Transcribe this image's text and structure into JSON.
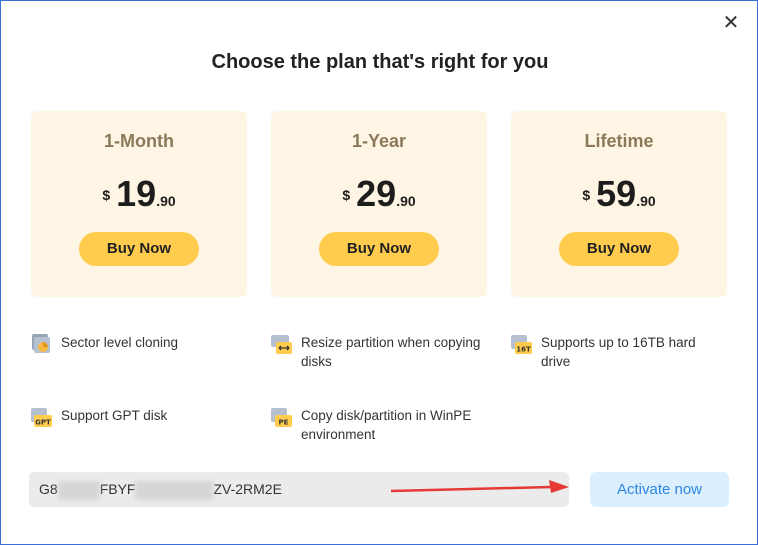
{
  "dialog": {
    "close_glyph": "✕",
    "title": "Choose the plan that's right for you"
  },
  "plans": [
    {
      "name": "1-Month",
      "currency": "$",
      "price_int": "19",
      "price_dec": ".90",
      "button": "Buy Now"
    },
    {
      "name": "1-Year",
      "currency": "$",
      "price_int": "29",
      "price_dec": ".90",
      "button": "Buy Now"
    },
    {
      "name": "Lifetime",
      "currency": "$",
      "price_int": "59",
      "price_dec": ".90",
      "button": "Buy Now"
    }
  ],
  "features": [
    {
      "icon": "sector-clone-icon",
      "line1": "Sector level cloning",
      "line2": ""
    },
    {
      "icon": "resize-partition-icon",
      "line1": "Resize partition when copying",
      "line2": "disks"
    },
    {
      "icon": "16tb-disk-icon",
      "line1": "Supports up to 16TB hard",
      "line2": "drive",
      "badge": "16T"
    },
    {
      "icon": "gpt-disk-icon",
      "line1": "Support GPT disk",
      "line2": "",
      "badge": "GPT"
    },
    {
      "icon": "winpe-disk-icon",
      "line1": "Copy disk/partition in WinPE",
      "line2": "environment",
      "badge": "PE"
    }
  ],
  "license": {
    "part1": "G8",
    "part2": "FBYF",
    "part3": "ZV-2RM2E",
    "activate_label": "Activate now"
  },
  "colors": {
    "card_bg": "#fff5e4",
    "button_yellow": "#ffcc4d",
    "activate_bg": "#dcefff",
    "activate_text": "#2e86de",
    "arrow_red": "#e53935"
  }
}
